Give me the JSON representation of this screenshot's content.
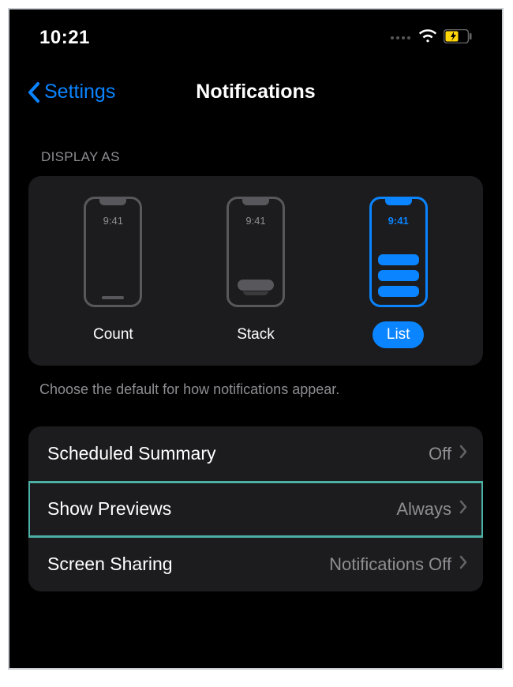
{
  "status": {
    "time": "10:21"
  },
  "nav": {
    "back_label": "Settings",
    "title": "Notifications"
  },
  "display_as": {
    "header": "DISPLAY AS",
    "phone_time": "9:41",
    "options": [
      {
        "label": "Count",
        "selected": false
      },
      {
        "label": "Stack",
        "selected": false
      },
      {
        "label": "List",
        "selected": true
      }
    ],
    "footer": "Choose the default for how notifications appear."
  },
  "rows": [
    {
      "label": "Scheduled Summary",
      "value": "Off"
    },
    {
      "label": "Show Previews",
      "value": "Always"
    },
    {
      "label": "Screen Sharing",
      "value": "Notifications Off"
    }
  ]
}
